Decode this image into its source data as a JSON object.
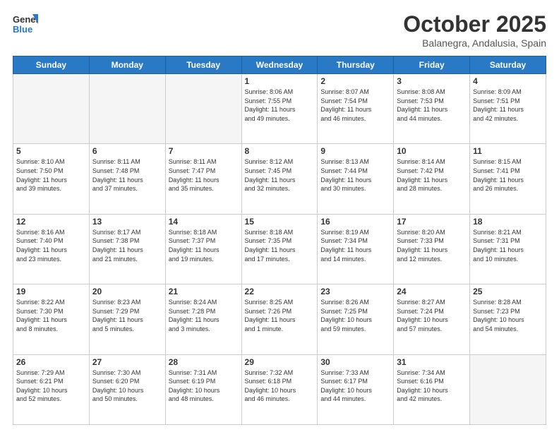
{
  "header": {
    "logo_line1": "General",
    "logo_line2": "Blue",
    "month": "October 2025",
    "location": "Balanegra, Andalusia, Spain"
  },
  "weekdays": [
    "Sunday",
    "Monday",
    "Tuesday",
    "Wednesday",
    "Thursday",
    "Friday",
    "Saturday"
  ],
  "weeks": [
    [
      {
        "day": "",
        "info": ""
      },
      {
        "day": "",
        "info": ""
      },
      {
        "day": "",
        "info": ""
      },
      {
        "day": "1",
        "info": "Sunrise: 8:06 AM\nSunset: 7:55 PM\nDaylight: 11 hours\nand 49 minutes."
      },
      {
        "day": "2",
        "info": "Sunrise: 8:07 AM\nSunset: 7:54 PM\nDaylight: 11 hours\nand 46 minutes."
      },
      {
        "day": "3",
        "info": "Sunrise: 8:08 AM\nSunset: 7:53 PM\nDaylight: 11 hours\nand 44 minutes."
      },
      {
        "day": "4",
        "info": "Sunrise: 8:09 AM\nSunset: 7:51 PM\nDaylight: 11 hours\nand 42 minutes."
      }
    ],
    [
      {
        "day": "5",
        "info": "Sunrise: 8:10 AM\nSunset: 7:50 PM\nDaylight: 11 hours\nand 39 minutes."
      },
      {
        "day": "6",
        "info": "Sunrise: 8:11 AM\nSunset: 7:48 PM\nDaylight: 11 hours\nand 37 minutes."
      },
      {
        "day": "7",
        "info": "Sunrise: 8:11 AM\nSunset: 7:47 PM\nDaylight: 11 hours\nand 35 minutes."
      },
      {
        "day": "8",
        "info": "Sunrise: 8:12 AM\nSunset: 7:45 PM\nDaylight: 11 hours\nand 32 minutes."
      },
      {
        "day": "9",
        "info": "Sunrise: 8:13 AM\nSunset: 7:44 PM\nDaylight: 11 hours\nand 30 minutes."
      },
      {
        "day": "10",
        "info": "Sunrise: 8:14 AM\nSunset: 7:42 PM\nDaylight: 11 hours\nand 28 minutes."
      },
      {
        "day": "11",
        "info": "Sunrise: 8:15 AM\nSunset: 7:41 PM\nDaylight: 11 hours\nand 26 minutes."
      }
    ],
    [
      {
        "day": "12",
        "info": "Sunrise: 8:16 AM\nSunset: 7:40 PM\nDaylight: 11 hours\nand 23 minutes."
      },
      {
        "day": "13",
        "info": "Sunrise: 8:17 AM\nSunset: 7:38 PM\nDaylight: 11 hours\nand 21 minutes."
      },
      {
        "day": "14",
        "info": "Sunrise: 8:18 AM\nSunset: 7:37 PM\nDaylight: 11 hours\nand 19 minutes."
      },
      {
        "day": "15",
        "info": "Sunrise: 8:18 AM\nSunset: 7:35 PM\nDaylight: 11 hours\nand 17 minutes."
      },
      {
        "day": "16",
        "info": "Sunrise: 8:19 AM\nSunset: 7:34 PM\nDaylight: 11 hours\nand 14 minutes."
      },
      {
        "day": "17",
        "info": "Sunrise: 8:20 AM\nSunset: 7:33 PM\nDaylight: 11 hours\nand 12 minutes."
      },
      {
        "day": "18",
        "info": "Sunrise: 8:21 AM\nSunset: 7:31 PM\nDaylight: 11 hours\nand 10 minutes."
      }
    ],
    [
      {
        "day": "19",
        "info": "Sunrise: 8:22 AM\nSunset: 7:30 PM\nDaylight: 11 hours\nand 8 minutes."
      },
      {
        "day": "20",
        "info": "Sunrise: 8:23 AM\nSunset: 7:29 PM\nDaylight: 11 hours\nand 5 minutes."
      },
      {
        "day": "21",
        "info": "Sunrise: 8:24 AM\nSunset: 7:28 PM\nDaylight: 11 hours\nand 3 minutes."
      },
      {
        "day": "22",
        "info": "Sunrise: 8:25 AM\nSunset: 7:26 PM\nDaylight: 11 hours\nand 1 minute."
      },
      {
        "day": "23",
        "info": "Sunrise: 8:26 AM\nSunset: 7:25 PM\nDaylight: 10 hours\nand 59 minutes."
      },
      {
        "day": "24",
        "info": "Sunrise: 8:27 AM\nSunset: 7:24 PM\nDaylight: 10 hours\nand 57 minutes."
      },
      {
        "day": "25",
        "info": "Sunrise: 8:28 AM\nSunset: 7:23 PM\nDaylight: 10 hours\nand 54 minutes."
      }
    ],
    [
      {
        "day": "26",
        "info": "Sunrise: 7:29 AM\nSunset: 6:21 PM\nDaylight: 10 hours\nand 52 minutes."
      },
      {
        "day": "27",
        "info": "Sunrise: 7:30 AM\nSunset: 6:20 PM\nDaylight: 10 hours\nand 50 minutes."
      },
      {
        "day": "28",
        "info": "Sunrise: 7:31 AM\nSunset: 6:19 PM\nDaylight: 10 hours\nand 48 minutes."
      },
      {
        "day": "29",
        "info": "Sunrise: 7:32 AM\nSunset: 6:18 PM\nDaylight: 10 hours\nand 46 minutes."
      },
      {
        "day": "30",
        "info": "Sunrise: 7:33 AM\nSunset: 6:17 PM\nDaylight: 10 hours\nand 44 minutes."
      },
      {
        "day": "31",
        "info": "Sunrise: 7:34 AM\nSunset: 6:16 PM\nDaylight: 10 hours\nand 42 minutes."
      },
      {
        "day": "",
        "info": ""
      }
    ]
  ]
}
